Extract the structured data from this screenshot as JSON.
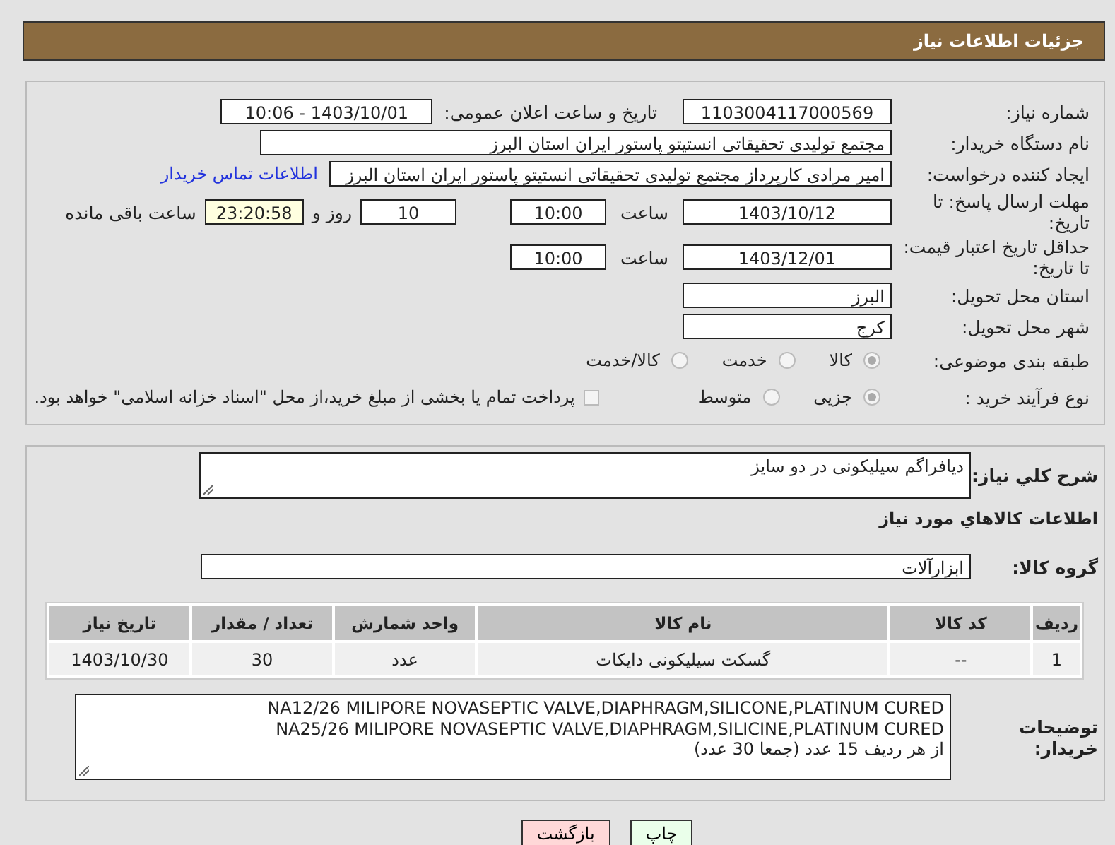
{
  "header": {
    "title": "جزئیات اطلاعات نیاز"
  },
  "fields": {
    "need_number": {
      "label": "شماره نیاز:",
      "value": "1103004117000569"
    },
    "announce": {
      "label": "تاریخ و ساعت اعلان عمومی:",
      "value": "1403/10/01 - 10:06"
    },
    "buyer": {
      "label": "نام دستگاه خریدار:",
      "value": "مجتمع تولیدی تحقیقاتی انستیتو پاستور ایران استان البرز"
    },
    "creator": {
      "label": "ایجاد کننده درخواست:",
      "value": "امیر مرادی کارپرداز مجتمع تولیدی تحقیقاتی انستیتو پاستور ایران استان البرز",
      "link": "اطلاعات تماس خریدار"
    },
    "deadline": {
      "label": "مهلت ارسال پاسخ: تا تاریخ:",
      "date": "1403/10/12",
      "time_label": "ساعت",
      "time": "10:00",
      "days": "10",
      "days_label": "روز و",
      "remaining": "23:20:58",
      "remaining_label": "ساعت باقی مانده"
    },
    "validity": {
      "label": "حداقل تاریخ اعتبار قیمت: تا تاریخ:",
      "date": "1403/12/01",
      "time_label": "ساعت",
      "time": "10:00"
    },
    "province": {
      "label": "استان محل تحویل:",
      "value": "البرز"
    },
    "city": {
      "label": "شهر محل تحویل:",
      "value": "کرج"
    }
  },
  "category": {
    "label": "طبقه بندی موضوعی:",
    "options": [
      {
        "label": "کالا",
        "selected": true
      },
      {
        "label": "خدمت",
        "selected": false
      },
      {
        "label": "کالا/خدمت",
        "selected": false
      }
    ]
  },
  "process": {
    "label": "نوع فرآیند خرید :",
    "options": [
      {
        "label": "جزیی",
        "selected": true
      },
      {
        "label": "متوسط",
        "selected": false
      }
    ],
    "treasury": {
      "label": "پرداخت تمام یا بخشی از مبلغ خرید،از محل \"اسناد خزانه اسلامی\" خواهد بود.",
      "checked": false
    }
  },
  "description": {
    "label": "شرح کلي نياز:",
    "value": "دیافراگم سیلیکونی در دو سایز"
  },
  "goods_title": "اطلاعات كالاهاي مورد نياز",
  "goods_group": {
    "label": "گروه کالا:",
    "value": "ابزارآلات"
  },
  "table": {
    "columns": [
      "ردیف",
      "کد کالا",
      "نام کالا",
      "واحد شمارش",
      "تعداد / مقدار",
      "تاریخ نیاز"
    ],
    "rows": [
      [
        "1",
        "--",
        "گسکت سیلیکونی دایکات",
        "عدد",
        "30",
        "1403/10/30"
      ]
    ]
  },
  "notes": {
    "label": "توضیحات خریدار:",
    "lines": [
      "NA12/26 MILIPORE NOVASEPTIC VALVE,DIAPHRAGM,SILICONE,PLATINUM CURED",
      "NA25/26 MILIPORE NOVASEPTIC VALVE,DIAPHRAGM,SILICINE,PLATINUM CURED",
      "از هر ردیف 15 عدد (جمعا 30 عدد)"
    ]
  },
  "buttons": [
    {
      "label": "چاپ",
      "kind": "print"
    },
    {
      "label": "بازگشت",
      "kind": "back"
    }
  ]
}
